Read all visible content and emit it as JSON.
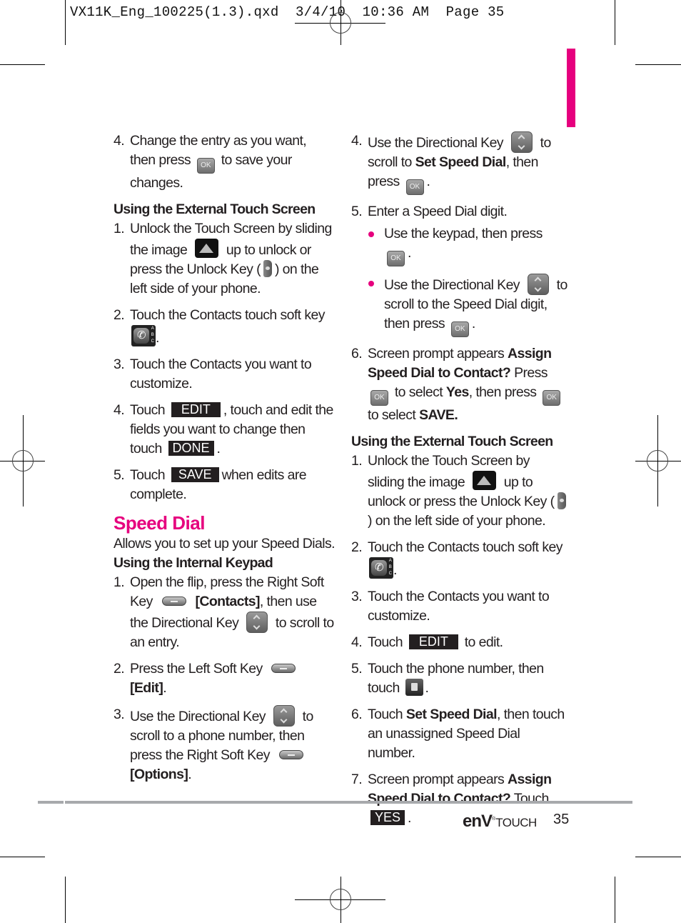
{
  "slug": "VX11K_Eng_100225(1.3).qxd  3/4/10  10:36 AM  Page 35",
  "colors": {
    "accent": "#e6007e",
    "text": "#231f20",
    "rule": "#a7a9ac"
  },
  "left_column": {
    "step4": {
      "num": "4.",
      "a": "Change the entry as you want, then press",
      "icon": "ok-key",
      "b": "to save your changes."
    },
    "heading_ext": "Using the External Touch Screen",
    "ext_steps": [
      {
        "num": "1.",
        "a": "Unlock the Touch Screen by sliding the image",
        "b": "up to unlock or press the Unlock Key (",
        "c": ") on the left side of your phone."
      },
      {
        "num": "2.",
        "a": "Touch the Contacts touch soft key",
        "b": "."
      },
      {
        "num": "3.",
        "a": "Touch the Contacts you want to customize."
      },
      {
        "num": "4.",
        "a": "Touch",
        "btn": "EDIT",
        "b": ",  touch and edit the fields you want to change then touch",
        "btn2": "DONE",
        "c": "."
      },
      {
        "num": "5.",
        "a": "Touch",
        "btn": "SAVE",
        "b": "when edits are complete."
      }
    ],
    "section_title": "Speed Dial",
    "intro": "Allows you to set up your Speed Dials.",
    "heading_int": "Using the Internal Keypad",
    "int_steps": [
      {
        "num": "1.",
        "a": "Open the flip, press the Right Soft Key",
        "bold": "[Contacts]",
        "b": ", then use the Directional Key",
        "c": "to scroll to an entry."
      },
      {
        "num": "2.",
        "a": "Press the Left Soft Key",
        "bold": "[Edit]",
        "b": "."
      },
      {
        "num": "3.",
        "a": "Use the Directional Key",
        "b": "to scroll to a phone number, then press the Right Soft Key",
        "bold": "[Options]",
        "c": "."
      }
    ]
  },
  "right_column": {
    "int_steps": [
      {
        "num": "4.",
        "a": "Use the Directional Key",
        "b": "to scroll to",
        "bold": "Set Speed Dial",
        "c": ", then press",
        "d": "."
      },
      {
        "num": "5.",
        "a": "Enter a Speed Dial digit.",
        "bullets": [
          {
            "a": "Use the keypad, then press",
            "b": "."
          },
          {
            "a": "Use the Directional Key",
            "b": "to scroll to the Speed Dial digit, then press",
            "c": "."
          }
        ]
      },
      {
        "num": "6.",
        "a": "Screen prompt appears",
        "bold1": "Assign Speed Dial to Contact?",
        "b": "Press",
        "c": "to select",
        "bold2": "Yes",
        "d": ", then press",
        "e": "to select",
        "bold3": "SAVE."
      }
    ],
    "heading_ext": "Using the External Touch Screen",
    "ext_steps": [
      {
        "num": "1.",
        "a": "Unlock the Touch Screen by sliding the image",
        "b": "up to unlock or press the Unlock Key (",
        "c": ") on the left side of your phone."
      },
      {
        "num": "2.",
        "a": "Touch the Contacts touch soft key",
        "b": "."
      },
      {
        "num": "3.",
        "a": "Touch the Contacts you want to customize."
      },
      {
        "num": "4.",
        "a": "Touch",
        "btn": "EDIT",
        "b": "to edit."
      },
      {
        "num": "5.",
        "a": "Touch the phone number, then touch",
        "b": "."
      },
      {
        "num": "6.",
        "a": "Touch",
        "bold": "Set Speed Dial",
        "b": ", then touch an unassigned Speed Dial number."
      },
      {
        "num": "7.",
        "a": "Screen prompt appears",
        "bold": "Assign Speed Dial to Contact?",
        "b": "Touch",
        "btn": "YES",
        "c": "."
      }
    ]
  },
  "footer": {
    "brand_env": "enV",
    "brand_mark": "®",
    "brand_touch": "TOUCH",
    "page_number": "35"
  },
  "ok_label": "OK",
  "contacts_abc": [
    "A",
    "B",
    "C"
  ],
  "phone_glyph": "✆"
}
